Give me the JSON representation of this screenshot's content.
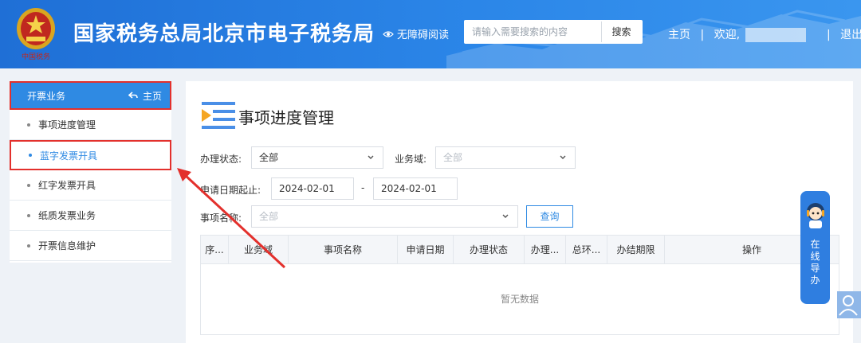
{
  "header": {
    "title": "国家税务总局北京市电子税务局",
    "accessibility_label": "无障碍阅读",
    "search_placeholder": "请输入需要搜索的内容",
    "search_button": "搜索",
    "home_link": "主页",
    "separator": "|",
    "welcome": "欢迎,",
    "logout": "退出",
    "emblem_text": "中国税务"
  },
  "sidebar": {
    "header_label": "开票业务",
    "home_link": "主页",
    "items": [
      {
        "label": "事项进度管理"
      },
      {
        "label": "蓝字发票开具"
      },
      {
        "label": "红字发票开具"
      },
      {
        "label": "纸质发票业务"
      },
      {
        "label": "开票信息维护"
      }
    ]
  },
  "main": {
    "title": "事项进度管理",
    "filters": {
      "status_label": "办理状态:",
      "status_value": "全部",
      "domain_label": "业务域:",
      "domain_placeholder": "全部",
      "date_label": "申请日期起止:",
      "date_start": "2024-02-01",
      "date_sep": "-",
      "date_end": "2024-02-01",
      "item_label": "事项名称:",
      "item_placeholder": "全部",
      "query_button": "查询"
    },
    "table": {
      "columns": [
        "序...",
        "业务域",
        "事项名称",
        "申请日期",
        "办理状态",
        "办理...",
        "总环...",
        "办结期限",
        "操作"
      ],
      "empty_text": "暂无数据"
    }
  },
  "guide": {
    "label": "在线导办"
  },
  "colors": {
    "header_blue": "#2b86e8",
    "accent": "#2f8ae3",
    "highlight_red": "#e3302c"
  }
}
